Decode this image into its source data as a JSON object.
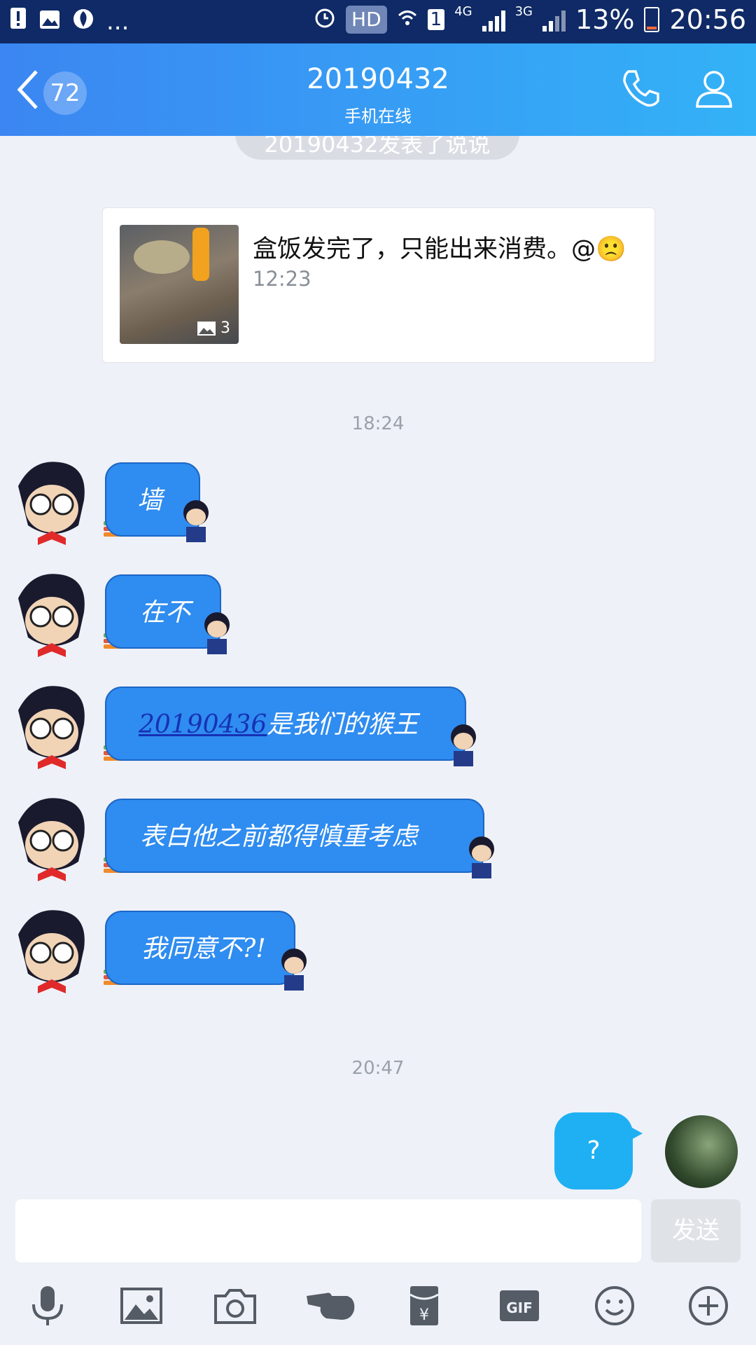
{
  "status_bar": {
    "left_more": "...",
    "hd": "HD",
    "sim": "1",
    "net1": "4G",
    "net2": "3G",
    "battery": "13%",
    "time": "20:56"
  },
  "header": {
    "back_count": "72",
    "title": "20190432",
    "subtitle": "手机在线"
  },
  "notice": "20190432发表了说说",
  "post_card": {
    "text": "盒饭发完了，只能出来消费。@🙁",
    "time": "12:23",
    "image_count": "3"
  },
  "timestamps": [
    "18:24",
    "20:47"
  ],
  "messages": [
    {
      "text": "墙"
    },
    {
      "text": "在不"
    },
    {
      "link": "20190436",
      "text": "是我们的猴王"
    },
    {
      "text": "表白他之前都得慎重考虑"
    },
    {
      "text": "我同意不?!"
    }
  ],
  "my_message": "?",
  "input": {
    "placeholder": "",
    "send_label": "发送"
  },
  "toolbar": {
    "gif_label": "GIF",
    "icons": [
      "microphone-icon",
      "image-icon",
      "camera-icon",
      "poke-icon",
      "red-packet-icon",
      "gif-icon",
      "emoji-icon",
      "plus-icon"
    ]
  },
  "colors": {
    "header_start": "#3b86f2",
    "header_end": "#33b2f7",
    "bubble": "#2f8cf0",
    "my_bubble": "#1fb0f3",
    "background": "#eef1f7"
  }
}
